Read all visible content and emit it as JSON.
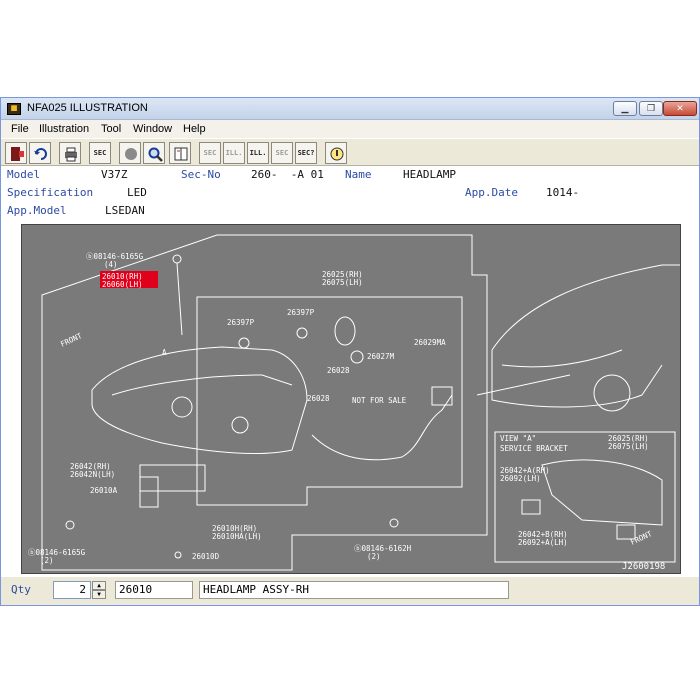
{
  "window": {
    "title": "NFA025 ILLUSTRATION",
    "icon": "app-icon",
    "controls": [
      "minimize-icon",
      "restore-icon",
      "close-icon"
    ]
  },
  "menu": [
    "File",
    "Illustration",
    "Tool",
    "Window",
    "Help"
  ],
  "toolbar": {
    "buttons": [
      "exit-icon",
      "undo-icon",
      "print-icon",
      "sec-icon",
      "circle-icon",
      "search-icon",
      "book-icon",
      "prev-sec-icon",
      "prev-ill-icon",
      "next-ill-icon",
      "next-sec-icon",
      "sec-query-icon",
      "info-icon"
    ],
    "labels": {
      "sec": "SEC",
      "ill": "ILL.",
      "secq": "SEC?"
    }
  },
  "info": {
    "model_label": "Model",
    "model_value": "V37Z",
    "secno_label": "Sec-No",
    "secno_value": "260-  -A 01",
    "name_label": "Name",
    "name_value": "HEADLAMP",
    "spec_label": "Specification",
    "spec_value": "LED",
    "appdate_label": "App.Date",
    "appdate_value": "1014-",
    "appmodel_label": "App.Model",
    "appmodel_value": "LSEDAN"
  },
  "illustration": {
    "labels": {
      "bolt_top": "ⓑ08146-6165G",
      "bolt_top_qty": "(4)",
      "p26010_rh": "26010(RH)",
      "p26060_lh": "26060(LH)",
      "p26025": "26025(RH)",
      "p26075": "26075(LH)",
      "front": "FRONT",
      "a_marker": "A",
      "p26397p_a": "26397P",
      "p26397p_b": "26397P",
      "p26029ma": "26029MA",
      "p26027m": "26027M",
      "p26028_a": "26028",
      "p26028_b": "26028",
      "not_for_sale": "NOT FOR SALE",
      "p26042_rh": "26042(RH)",
      "p26042n_lh": "26042N(LH)",
      "p26010a": "26010A",
      "p26010h_rh": "26010H(RH)",
      "p26010ha_lh": "26010HA(LH)",
      "p26010d": "26010D",
      "bolt_bl": "ⓑ08146-6165G",
      "bolt_bl_qty": "(2)",
      "bolt_br": "ⓑ08146-6162H",
      "bolt_br_qty": "(2)",
      "view_a": "VIEW \"A\"",
      "service_bracket": "SERVICE BRACKET",
      "v_26025": "26025(RH)",
      "v_26075": "26075(LH)",
      "v_26042a": "26042+A(RH)",
      "v_26092": "26092(LH)",
      "v_26042b": "26042+B(RH)",
      "v_26092a": "26092+A(LH)",
      "v_front": "FRONT",
      "code": "J2600198"
    },
    "highlight_color": "#e0001b"
  },
  "status": {
    "qty_label": "Qty",
    "qty_value": "2",
    "part_no": "26010",
    "part_name": "HEADLAMP ASSY-RH"
  },
  "colors": {
    "label_blue": "#2c4ba5",
    "illus_bg": "#7a7a7a"
  }
}
